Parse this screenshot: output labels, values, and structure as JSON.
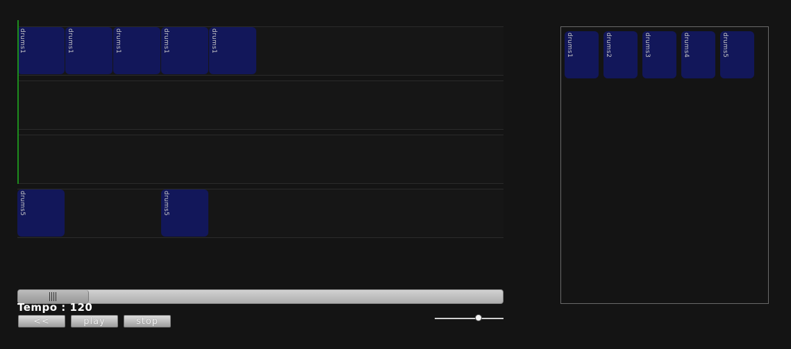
{
  "tracks": [
    {
      "clips": [
        {
          "label": "drums1",
          "start": 0,
          "length": 1
        },
        {
          "label": "drums1",
          "start": 1,
          "length": 1
        },
        {
          "label": "drums1",
          "start": 2,
          "length": 1
        },
        {
          "label": "drums1",
          "start": 3,
          "length": 1
        },
        {
          "label": "drums1",
          "start": 4,
          "length": 1
        }
      ]
    },
    {
      "clips": []
    },
    {
      "clips": []
    },
    {
      "clips": [
        {
          "label": "drums5",
          "start": 0,
          "length": 1
        },
        {
          "label": "drums5",
          "start": 3,
          "length": 1
        }
      ]
    }
  ],
  "scrollbar": {
    "position_fraction": 0.0,
    "visible_fraction": 0.145
  },
  "tempo": {
    "label": "Tempo : 120"
  },
  "transport": {
    "rewind_label": "<<",
    "play_label": "play",
    "stop_label": "stop"
  },
  "volume": {
    "value": 0.64
  },
  "library": {
    "clips": [
      {
        "label": "drums1"
      },
      {
        "label": "drums2"
      },
      {
        "label": "drums3"
      },
      {
        "label": "drums4"
      },
      {
        "label": "drums5"
      }
    ]
  },
  "colors": {
    "background": "#141414",
    "clip": "#12175a",
    "playhead": "#1d8d1d"
  }
}
